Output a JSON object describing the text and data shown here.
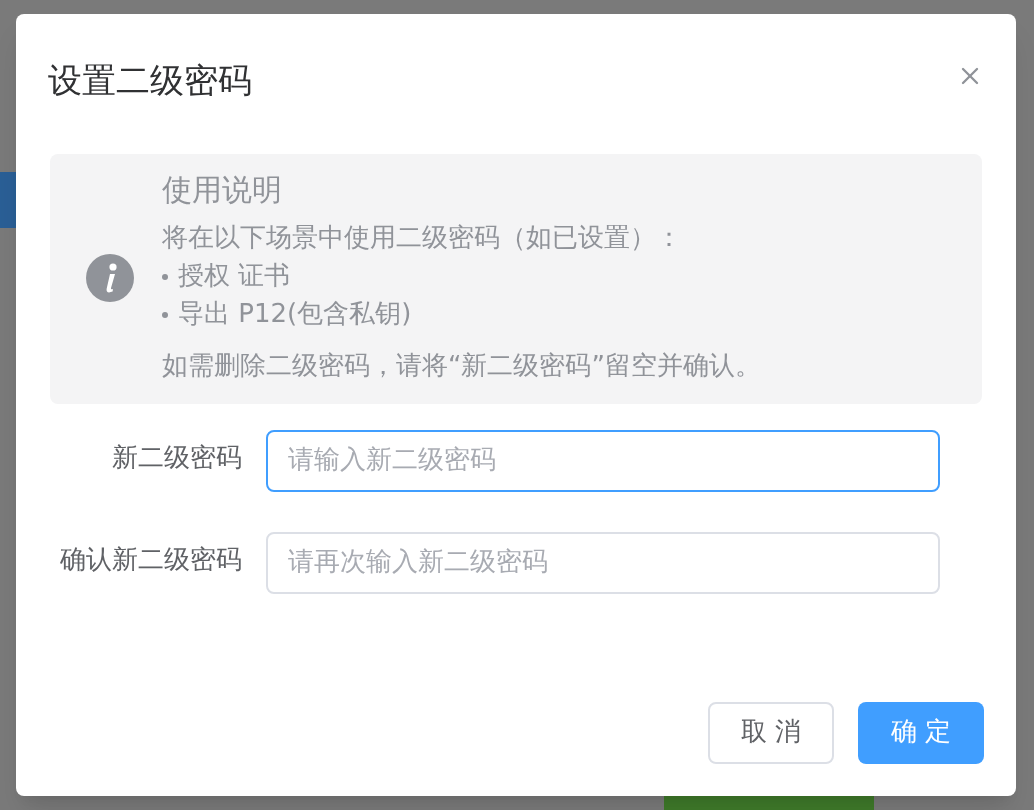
{
  "dialog": {
    "title": "设置二级密码",
    "notice": {
      "title": "使用说明",
      "intro": "将在以下场景中使用二级密码（如已设置）：",
      "bullets": [
        "授权 证书",
        "导出 P12(包含私钥)"
      ],
      "note": "如需删除二级密码，请将“新二级密码”留空并确认。"
    },
    "fields": [
      {
        "label": "新二级密码",
        "placeholder": "请输入新二级密码",
        "focused": true
      },
      {
        "label": "确认新二级密码",
        "placeholder": "请再次输入新二级密码",
        "focused": false
      }
    ],
    "buttons": [
      {
        "label": "取 消",
        "kind": "secondary"
      },
      {
        "label": "确 定",
        "kind": "primary"
      }
    ]
  }
}
